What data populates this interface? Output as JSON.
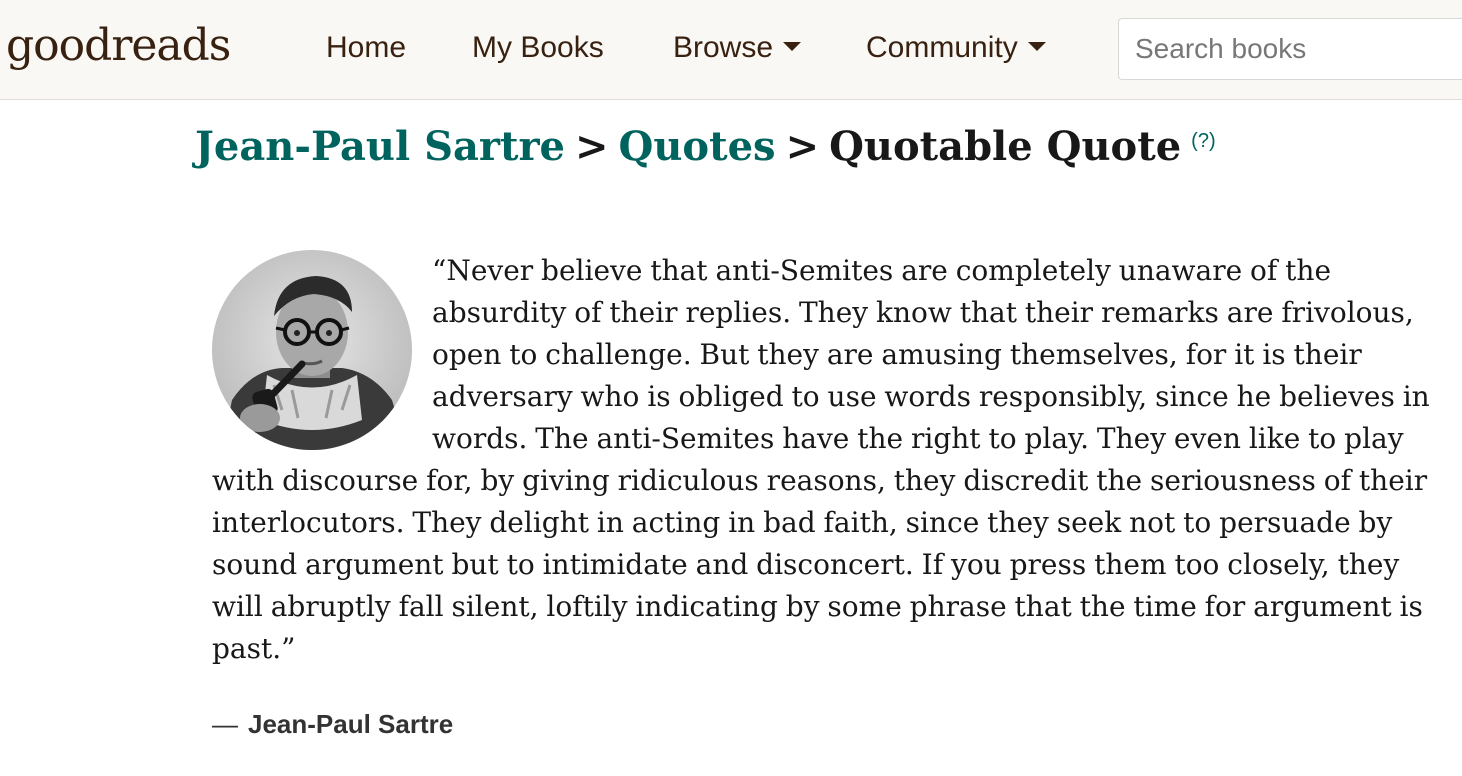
{
  "header": {
    "logo": "goodreads",
    "nav": {
      "home": "Home",
      "my_books": "My Books",
      "browse": "Browse",
      "community": "Community"
    },
    "search_placeholder": "Search books"
  },
  "breadcrumb": {
    "author": "Jean-Paul Sartre",
    "sep1": ">",
    "quotes": "Quotes",
    "sep2": ">",
    "current": "Quotable Quote",
    "help": "(?)"
  },
  "quote": {
    "text": "“Never believe that anti-Semites are completely unaware of the absurdity of their replies. They know that their remarks are frivolous, open to challenge. But they are amusing themselves, for it is their adversary who is obliged to use words responsibly, since he believes in words. The anti-Semites have the right to play. They even like to play with discourse for, by giving ridiculous reasons, they discredit the seriousness of their interlocutors. They delight in acting in bad faith, since they seek not to persuade by sound argument but to intimidate and disconcert. If you press them too closely, they will abruptly fall silent, loftily indicating by some phrase that the time for argument is past.”",
    "dash": "―",
    "author": "Jean-Paul Sartre"
  },
  "colors": {
    "header_bg": "#f9f8f4",
    "brand_brown": "#382110",
    "link_green": "#00635d",
    "text": "#181818"
  }
}
